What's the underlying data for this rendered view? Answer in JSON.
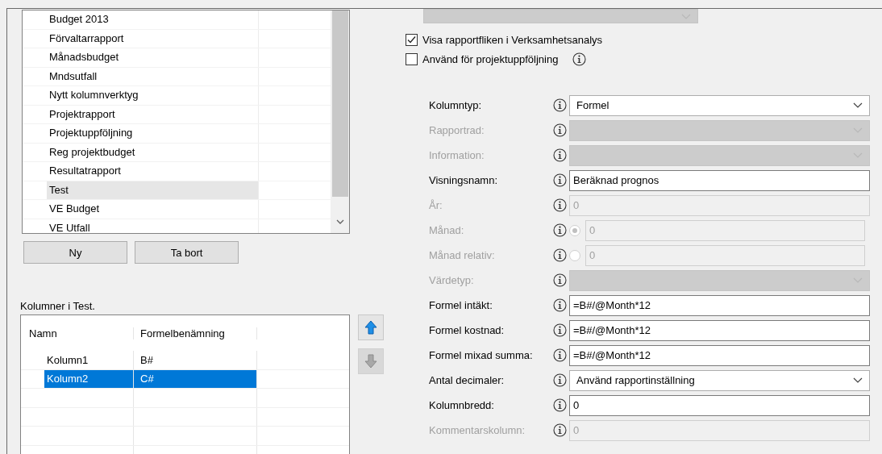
{
  "report_list": {
    "items": [
      {
        "label": "Budget 2013",
        "selected": false
      },
      {
        "label": "Förvaltarrapport",
        "selected": false
      },
      {
        "label": "Månadsbudget",
        "selected": false
      },
      {
        "label": "Mndsutfall",
        "selected": false
      },
      {
        "label": "Nytt kolumnverktyg",
        "selected": false
      },
      {
        "label": "Projektrapport",
        "selected": false
      },
      {
        "label": "Projektuppföljning",
        "selected": false
      },
      {
        "label": "Reg projektbudget",
        "selected": false
      },
      {
        "label": "Resultatrapport",
        "selected": false
      },
      {
        "label": "Test",
        "selected": true
      },
      {
        "label": "VE Budget",
        "selected": false
      },
      {
        "label": "VE Utfall",
        "selected": false
      }
    ]
  },
  "list_buttons": [
    "Ny",
    "Ta bort"
  ],
  "columns_title": "Kolumner i Test.",
  "columns_table": {
    "columns": [
      "Namn",
      "Formelbenämning"
    ],
    "rows": [
      {
        "cells": [
          "Kolumn1",
          "B#"
        ],
        "selected": false
      },
      {
        "cells": [
          "Kolumn2",
          "C#"
        ],
        "selected": true
      }
    ]
  },
  "move_buttons": [
    {
      "kind": "up",
      "disabled": false
    },
    {
      "kind": "down",
      "disabled": true
    }
  ],
  "top_select": {
    "disabled": true
  },
  "checkboxes": [
    {
      "label": "Visa rapportfliken i Verksamhetsanalys",
      "checked": true,
      "info": false
    },
    {
      "label": "Använd för projektuppföljning",
      "checked": false,
      "info": true
    }
  ],
  "fields": [
    {
      "label": "Kolumntyp:",
      "kind": "select",
      "value": "Formel",
      "disabled": false
    },
    {
      "label": "Rapportrad:",
      "kind": "select",
      "disabled": true
    },
    {
      "label": "Information:",
      "kind": "select",
      "disabled": true
    },
    {
      "label": "Visningsnamn:",
      "kind": "text",
      "value": "Beräknad prognos",
      "disabled": false
    },
    {
      "label": "År:",
      "kind": "text",
      "value": "0",
      "disabled": true
    },
    {
      "label": "Månad:",
      "kind": "radio_text",
      "value": "0",
      "disabled": true,
      "selected": true
    },
    {
      "label": "Månad relativ:",
      "kind": "radio_text",
      "value": "0",
      "disabled": true,
      "selected": false
    },
    {
      "label": "Värdetyp:",
      "kind": "select",
      "disabled": true
    },
    {
      "label": "Formel intäkt:",
      "kind": "text",
      "value": "=B#/@Month*12",
      "disabled": false
    },
    {
      "label": "Formel kostnad:",
      "kind": "text",
      "value": "=B#/@Month*12",
      "disabled": false
    },
    {
      "label": "Formel mixad summa:",
      "kind": "text",
      "value": "=B#/@Month*12",
      "disabled": false
    },
    {
      "label": "Antal decimaler:",
      "kind": "select",
      "value": "Använd rapportinställning",
      "disabled": false
    },
    {
      "label": "Kolumnbredd:",
      "kind": "text",
      "value": "0",
      "disabled": false
    },
    {
      "label": "Kommentarskolumn:",
      "kind": "text",
      "value": "0",
      "disabled": true
    }
  ]
}
